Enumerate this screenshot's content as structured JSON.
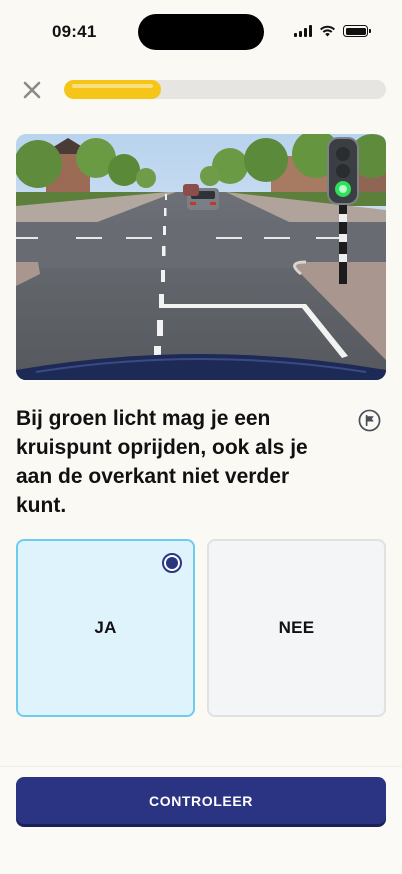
{
  "status_bar": {
    "time": "09:41"
  },
  "header": {
    "close_icon": "close-x-icon",
    "progress": 0.3
  },
  "scene": {
    "description_icon": "intersection-photo",
    "traffic_light_state": "green"
  },
  "question": {
    "text": "Bij groen licht mag je een kruispunt oprijden, ook als je aan de overkant niet verder kunt.",
    "flag_icon": "flag-icon"
  },
  "answers": [
    {
      "label": "JA",
      "selected": true
    },
    {
      "label": "NEE",
      "selected": false
    }
  ],
  "footer": {
    "check_label": "CONTROLEER"
  },
  "colors": {
    "accent": "#2b3482",
    "progress": "#f5c518",
    "selected_bg": "#dff3fd",
    "selected_border": "#6fcbee"
  }
}
